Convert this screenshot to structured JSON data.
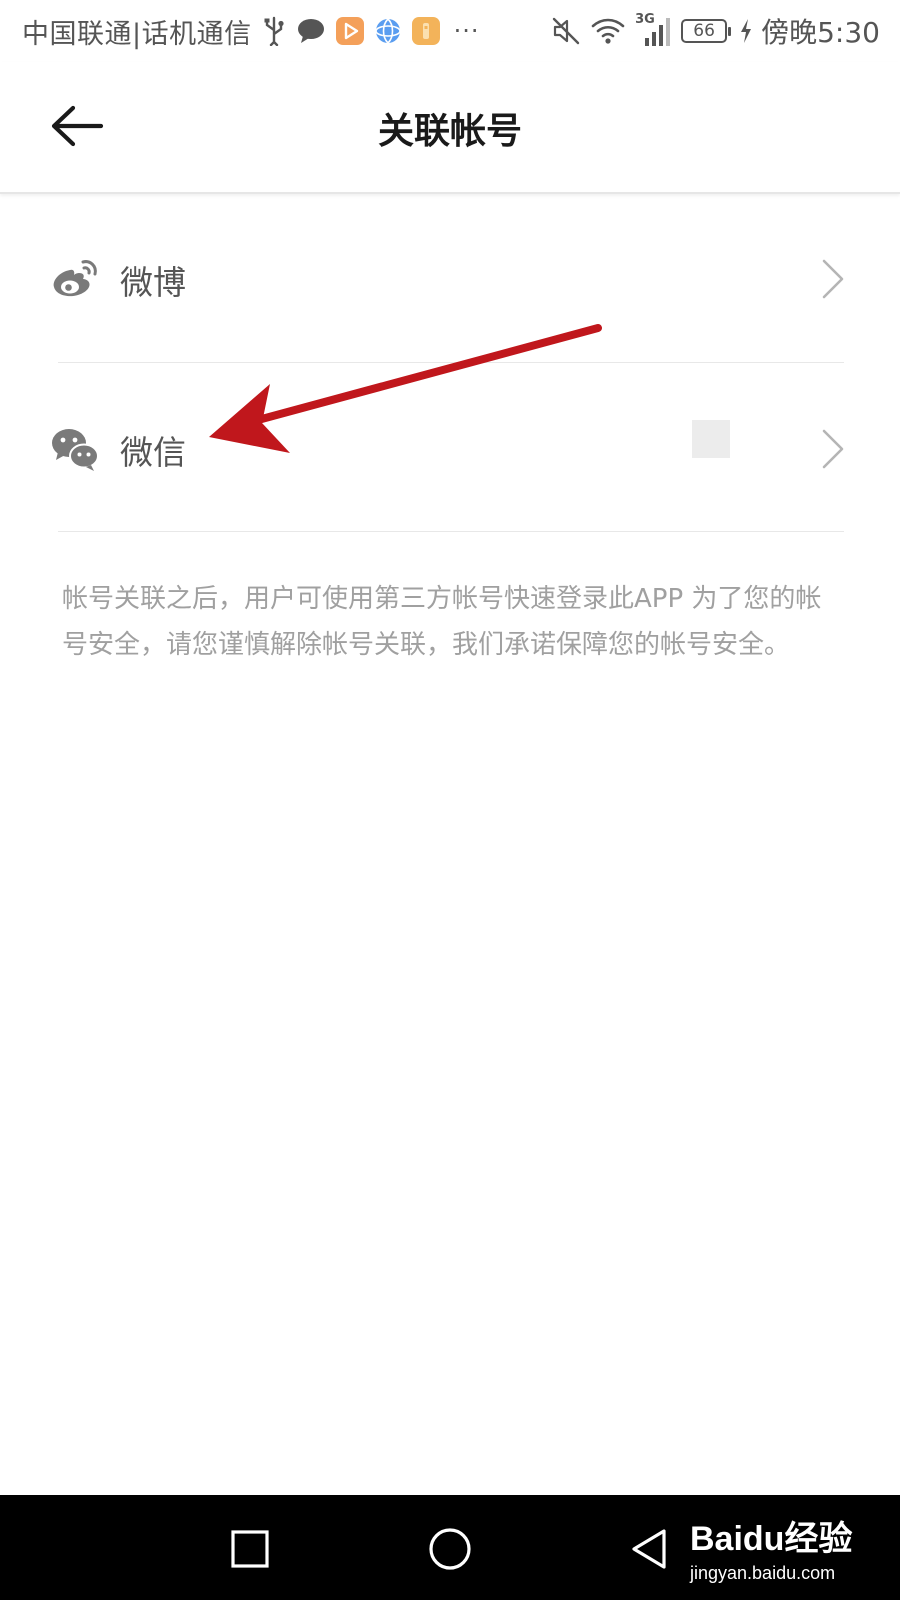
{
  "status_bar": {
    "carrier": "中国联通|话机通信",
    "overflow": "···",
    "network_type": "3G",
    "battery_level": "66",
    "time": "傍晚5:30",
    "icons": [
      "usb-icon",
      "chat-icon",
      "video-app-icon",
      "browser-app-icon",
      "notes-app-icon",
      "mute-icon",
      "wifi-icon",
      "signal-icon",
      "battery-icon",
      "charging-icon"
    ]
  },
  "header": {
    "title": "关联帐号"
  },
  "accounts": {
    "weibo": {
      "label": "微博",
      "icon": "weibo-icon"
    },
    "wechat": {
      "label": "微信",
      "icon": "wechat-icon"
    }
  },
  "note": "帐号关联之后，用户可使用第三方帐号快速登录此APP 为了您的帐号安全，请您谨慎解除帐号关联，我们承诺保障您的帐号安全。",
  "watermark": {
    "brand": "Baidu经验",
    "url": "jingyan.baidu.com"
  },
  "colors": {
    "annotation_arrow": "#c0171c",
    "text_secondary": "#a0a0a0",
    "video_app": "#f4a05a",
    "browser_app": "#5a9df0",
    "notes_app": "#f3b35a"
  }
}
